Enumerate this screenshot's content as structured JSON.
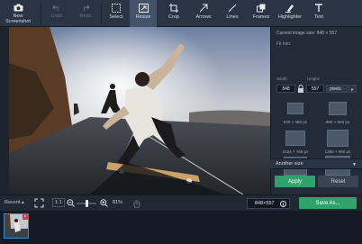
{
  "toolbar": {
    "items": [
      {
        "label": "New\nScreenshot",
        "icon": "camera-icon"
      },
      {
        "label": "Undo",
        "icon": "undo-icon"
      },
      {
        "label": "Redo",
        "icon": "redo-icon"
      },
      {
        "label": "Select",
        "icon": "select-icon"
      },
      {
        "label": "Resize",
        "icon": "resize-icon"
      },
      {
        "label": "Crop",
        "icon": "crop-icon"
      },
      {
        "label": "Arrows",
        "icon": "arrow-icon"
      },
      {
        "label": "Lines",
        "icon": "line-icon"
      },
      {
        "label": "Frames",
        "icon": "frames-icon"
      },
      {
        "label": "Highlighter",
        "icon": "highlighter-icon"
      },
      {
        "label": "Text",
        "icon": "text-icon"
      }
    ]
  },
  "panel": {
    "current_size": "Current image size: 848 × 557",
    "fit_into": "Fit into:",
    "width_label": "Width:",
    "height_label": "Height:",
    "width_value": "848",
    "height_value": "557",
    "unit": "pixels",
    "presets": [
      "640 × 480 px",
      "800 × 600 px",
      "1024 × 768 px",
      "1280 × 960 px",
      "1600 × 1200 px",
      "2048 × 1536 px"
    ],
    "another_size": "Another size",
    "apply": "Apply",
    "reset": "Reset"
  },
  "bottombar": {
    "recent": "Recent",
    "one_to_one": "1:1",
    "zoom": "81%",
    "image_size": "848×557",
    "save": "Save As..."
  },
  "colors": {
    "accent_green": "#2fa36b",
    "toolbar_bg": "#2a3442",
    "active_tool_bg": "#43536a",
    "selection_blue": "#2f8fd8"
  }
}
